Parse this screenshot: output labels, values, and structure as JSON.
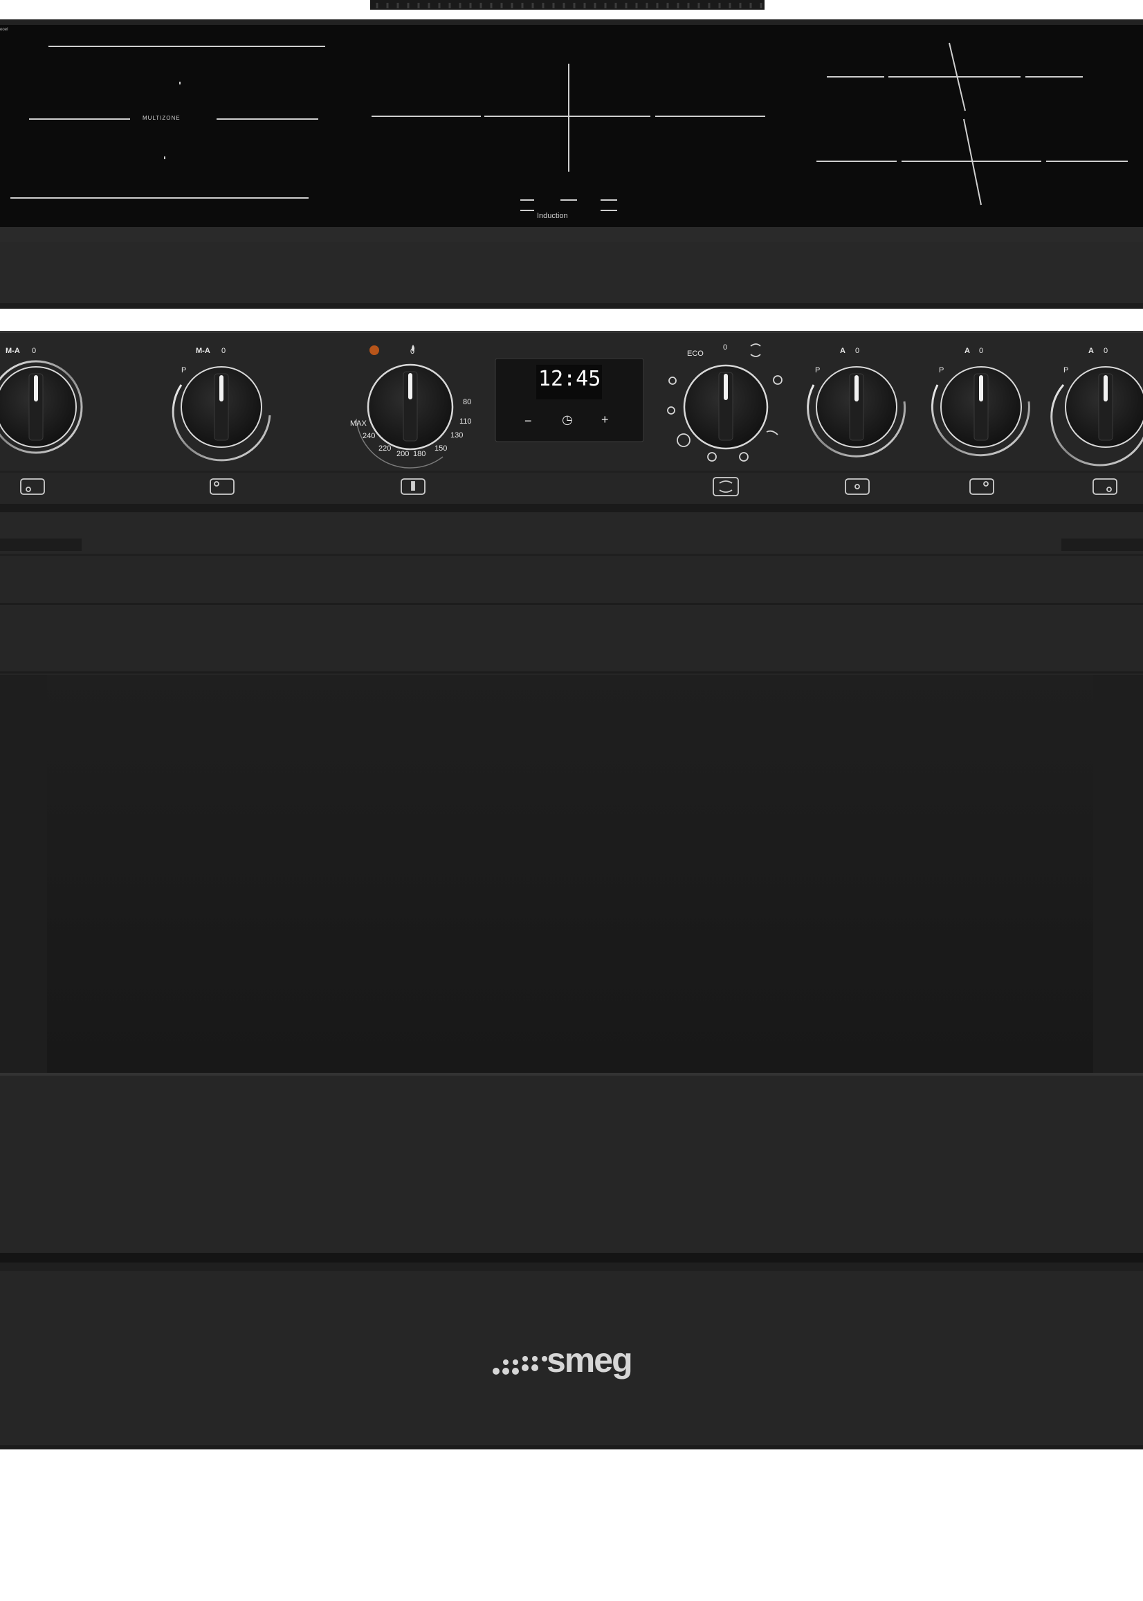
{
  "hob": {
    "zone_left_label": "MULTIZONE",
    "zone_center_label": "Induction",
    "corner_mark": "ᵉᵒᵉˡ"
  },
  "controls": {
    "knob1": {
      "top_left": "M-A",
      "top_right": "0"
    },
    "knob2": {
      "top_left": "M-A",
      "top_right": "0",
      "side": "P"
    },
    "thermostat": {
      "indicator_color": "#b8551a",
      "top": "0",
      "scale": [
        "80",
        "110",
        "130",
        "150",
        "180",
        "200",
        "220",
        "240",
        "MAX"
      ]
    },
    "display": {
      "time": "12:45",
      "minus": "−",
      "clock": "◷",
      "plus": "+"
    },
    "function_knob": {
      "top_left": "ECO",
      "top": "0"
    },
    "knob5": {
      "side": "P",
      "top_left": "A",
      "top_right": "0"
    },
    "knob6": {
      "side": "P",
      "top_left": "A",
      "top_right": "0"
    },
    "knob7": {
      "side": "P",
      "top_left": "A",
      "top_right": "0"
    }
  },
  "brand": {
    "logo_text": "smeg"
  },
  "colors": {
    "body": "#262626",
    "hob_glass": "#0b0b0b",
    "chrome": "#d9d9d9",
    "background": "#ffffff"
  }
}
